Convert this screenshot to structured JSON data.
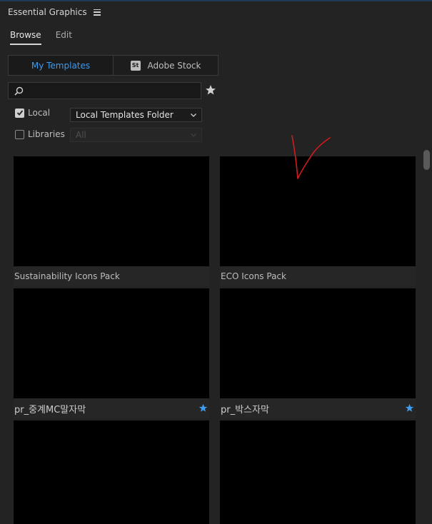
{
  "colors": {
    "accent": "#3d9bf0",
    "background": "#232323",
    "thumbnail": "#000000",
    "annotation": "#d01c1c"
  },
  "panel": {
    "title": "Essential Graphics",
    "menu_icon": "hamburger-menu-icon"
  },
  "tabs": [
    {
      "label": "Browse",
      "active": true
    },
    {
      "label": "Edit",
      "active": false
    }
  ],
  "source": {
    "my_templates": "My Templates",
    "adobe_stock": "Adobe Stock",
    "stock_badge": "St"
  },
  "search": {
    "value": "",
    "placeholder": "",
    "icon": "search-icon",
    "favorites_icon": "star-icon"
  },
  "filters": {
    "local": {
      "label": "Local",
      "checked": true,
      "folder": "Local Templates Folder"
    },
    "libraries": {
      "label": "Libraries",
      "checked": false,
      "value": "All"
    }
  },
  "templates": [
    {
      "name": "Sustainability Icons Pack",
      "favorite": false
    },
    {
      "name": "ECO Icons Pack",
      "favorite": false
    },
    {
      "name": "pr_중계MC말자막",
      "favorite": true
    },
    {
      "name": "pr_박스자막",
      "favorite": true
    },
    {
      "name": "",
      "favorite": false
    },
    {
      "name": "",
      "favorite": false
    }
  ]
}
